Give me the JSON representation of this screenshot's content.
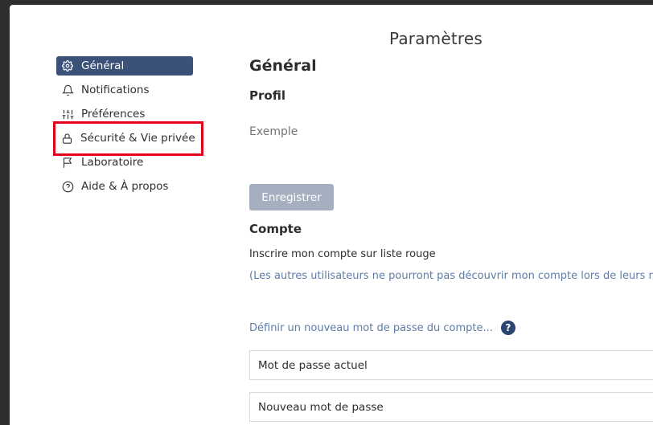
{
  "dialog": {
    "title": "Paramètres"
  },
  "sidebar": {
    "items": [
      {
        "label": "Général",
        "icon": "gear-icon",
        "active": true
      },
      {
        "label": "Notifications",
        "icon": "bell-icon"
      },
      {
        "label": "Préférences",
        "icon": "sliders-icon"
      },
      {
        "label": "Sécurité & Vie privée",
        "icon": "lock-icon"
      },
      {
        "label": "Laboratoire",
        "icon": "flag-icon"
      },
      {
        "label": "Aide & À propos",
        "icon": "help-circle-icon"
      }
    ]
  },
  "main": {
    "heading": "Général",
    "profile": {
      "title": "Profil",
      "display_name_placeholder": "Exemple",
      "save_label": "Enregistrer"
    },
    "account": {
      "title": "Compte",
      "blacklist_label": "Inscrire mon compte sur liste rouge",
      "blacklist_hint": "(Les autres utilisateurs ne pourront pas découvrir mon compte lors de leurs reche",
      "change_password_label": "Définir un nouveau mot de passe du compte...",
      "help_glyph": "?",
      "current_password_placeholder": "Mot de passe actuel",
      "new_password_placeholder": "Nouveau mot de passe"
    }
  },
  "colors": {
    "accent": "#3c5178",
    "highlight": "#e2001a",
    "link": "#5e7da6",
    "disabled_button": "#a6afbf"
  }
}
